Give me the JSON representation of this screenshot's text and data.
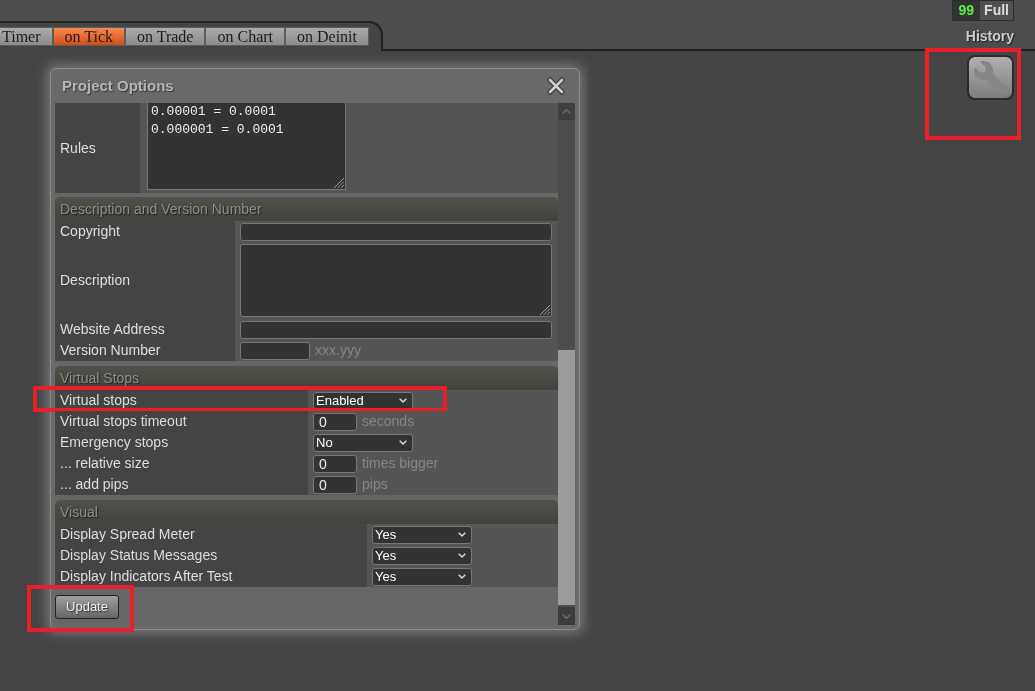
{
  "tabs": [
    {
      "label": "Timer",
      "selected": false
    },
    {
      "label": "on Tick",
      "selected": true
    },
    {
      "label": "on Trade",
      "selected": false
    },
    {
      "label": "on Chart",
      "selected": false
    },
    {
      "label": "on Deinit",
      "selected": false
    }
  ],
  "history": {
    "count": "99",
    "mode": "Full",
    "label": "History"
  },
  "settings_button": {
    "highlighted": true
  },
  "dialog": {
    "title": "Project Options",
    "rules": {
      "label": "Rules",
      "lines": [
        "0.00001 = 0.0001",
        "0.000001 = 0.0001"
      ]
    },
    "sections": [
      {
        "title": "Description and Version Number",
        "rows": [
          {
            "kind": "text",
            "label": "Copyright",
            "highlighted": false
          },
          {
            "kind": "textarea",
            "label": "Description",
            "highlighted": false
          },
          {
            "kind": "text",
            "label": "Website Address",
            "highlighted": false
          },
          {
            "kind": "short",
            "label": "Version Number",
            "note": "xxx.yyy",
            "highlighted": false
          }
        ]
      },
      {
        "title": "Virtual Stops",
        "rows": [
          {
            "kind": "select",
            "label": "Virtual stops",
            "value": "Enabled",
            "highlighted": true
          },
          {
            "kind": "number",
            "label": "Virtual stops timeout",
            "value": "0",
            "note": "seconds",
            "highlighted": false
          },
          {
            "kind": "select",
            "label": "Emergency stops",
            "value": "No",
            "highlighted": false
          },
          {
            "kind": "number",
            "label": "... relative size",
            "value": "0",
            "note": "times bigger",
            "highlighted": false
          },
          {
            "kind": "number",
            "label": "... add pips",
            "value": "0",
            "note": "pips",
            "highlighted": false
          }
        ]
      },
      {
        "title": "Visual",
        "rows": [
          {
            "kind": "select",
            "label": "Display Spread Meter",
            "value": "Yes",
            "highlighted": false
          },
          {
            "kind": "select",
            "label": "Display Status Messages",
            "value": "Yes",
            "highlighted": false
          },
          {
            "kind": "select",
            "label": "Display Indicators After Test",
            "value": "Yes",
            "highlighted": false
          }
        ]
      }
    ],
    "update_button": {
      "label": "Update",
      "highlighted": true
    }
  }
}
